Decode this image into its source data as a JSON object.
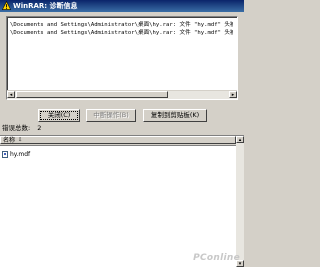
{
  "window": {
    "title": "WinRAR: 诊断信息"
  },
  "messages": [
    "\\Documents and Settings\\Administrator\\桌面\\hy.rar: 文件 \"hy.mdf\" 头被破坏",
    "\\Documents and Settings\\Administrator\\桌面\\hy.rar: 文件 \"hy.mdf\" 头被破坏"
  ],
  "buttons": {
    "close": "关闭(C)",
    "interrupt": "中断操作(B)",
    "copy": "复制到剪贴板(K)"
  },
  "errors": {
    "label": "错误总数:",
    "count": "2"
  },
  "list": {
    "column_name": "名称",
    "files": [
      "hy.mdf"
    ]
  },
  "watermark": "PConline",
  "colors": {
    "titlebar": "#0a246a",
    "face": "#d4d0c8"
  }
}
